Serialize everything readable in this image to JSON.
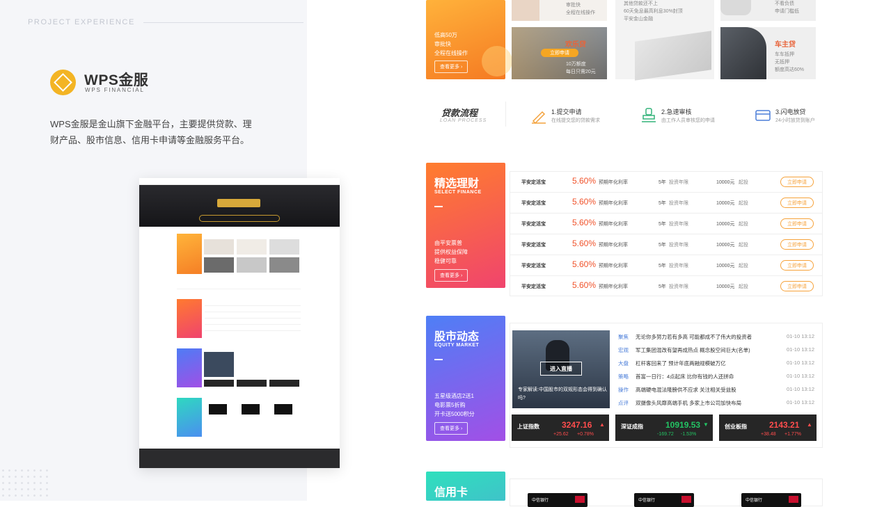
{
  "left": {
    "label": "PROJECT EXPERIENCE",
    "logo_title": "WPS金服",
    "logo_subtitle": "WPS FINANCIAL",
    "intro": "WPS金服是金山旗下金融平台，主要提供贷款、理财产品、股市信息、信用卡申请等金融服务平台。"
  },
  "loan_card": {
    "lines": [
      "低高50万",
      "审批快",
      "全程在线操作"
    ],
    "more_label": "查看更多 ›"
  },
  "top_snippets": {
    "a_lines": [
      "审批快",
      "全程在线操作"
    ],
    "b_lines": [
      "其他贷款还不上",
      "60天免息最高利息30%封顶",
      "平安金山金融"
    ],
    "c_lines": [
      "不看负债",
      "申请门槛低"
    ]
  },
  "products": [
    {
      "name": "欢乐贷",
      "button": "立即申请",
      "lines": [
        "10万额度",
        "每日只需20元"
      ]
    },
    {
      "name": "车主贷",
      "lines": [
        "车车抵押",
        "无抵押",
        "额度高达60%"
      ]
    }
  ],
  "loan_process": {
    "title": "贷款流程",
    "subtitle": "LOAN PROCESS",
    "steps": [
      {
        "title": "1.提交申请",
        "desc": "在线提交您的贷款需求",
        "icon": "pen-icon",
        "color": "#f4a23c"
      },
      {
        "title": "2.急速审核",
        "desc": "由工作人员审核您的申请",
        "icon": "stamp-icon",
        "color": "#33b37a"
      },
      {
        "title": "3.闪电放贷",
        "desc": "24小时放贷到账户",
        "icon": "card-icon",
        "color": "#4b7ed9"
      }
    ]
  },
  "finance": {
    "title": "精选理财",
    "subtitle": "SELECT FINANCE",
    "lines": [
      "由平安票普",
      "提供权益保障",
      "稳健可靠"
    ],
    "more_label": "查看更多 ›",
    "rows": [
      {
        "name": "平安定活宝",
        "rate": "5.60%",
        "rate_label": "预期年化利率",
        "term": "5年",
        "term_label": "投资年限",
        "amount": "10000元",
        "amount_label": "起投",
        "button": "立即申请"
      },
      {
        "name": "平安定活宝",
        "rate": "5.60%",
        "rate_label": "预期年化利率",
        "term": "5年",
        "term_label": "投资年限",
        "amount": "10000元",
        "amount_label": "起投",
        "button": "立即申请"
      },
      {
        "name": "平安定活宝",
        "rate": "5.60%",
        "rate_label": "预期年化利率",
        "term": "5年",
        "term_label": "投资年限",
        "amount": "10000元",
        "amount_label": "起投",
        "button": "立即申请"
      },
      {
        "name": "平安定活宝",
        "rate": "5.60%",
        "rate_label": "预期年化利率",
        "term": "5年",
        "term_label": "投资年限",
        "amount": "10000元",
        "amount_label": "起投",
        "button": "立即申请"
      },
      {
        "name": "平安定活宝",
        "rate": "5.60%",
        "rate_label": "预期年化利率",
        "term": "5年",
        "term_label": "投资年限",
        "amount": "10000元",
        "amount_label": "起投",
        "button": "立即申请"
      },
      {
        "name": "平安定活宝",
        "rate": "5.60%",
        "rate_label": "预期年化利率",
        "term": "5年",
        "term_label": "投资年限",
        "amount": "10000元",
        "amount_label": "起投",
        "button": "立即申请"
      }
    ]
  },
  "equity": {
    "title": "股市动态",
    "subtitle": "EQUITY MARKET",
    "lines": [
      "五星级酒店2送1",
      "电影票5折购",
      "开卡送5000积分"
    ],
    "more_label": "查看更多 ›",
    "live_button": "进入直播",
    "caption": "专家解读:中国股市的双规形态会得到确认吗?",
    "news": [
      {
        "tag": "聚焦",
        "title": "无论你多努力若有多高 可能都成不了伟大的投资者",
        "time": "01-10 13:12"
      },
      {
        "tag": "宏观",
        "title": "军工集团混改有望再成热点 概念股空间巨大(名单)",
        "time": "01-10 13:12"
      },
      {
        "tag": "大盘",
        "title": "杠杆客回来了 预计年底两融规模破万亿",
        "time": "01-10 13:12"
      },
      {
        "tag": "策略",
        "title": "首富一日行：4点起床 比你有钱的人还拼命",
        "time": "01-10 13:12"
      },
      {
        "tag": "操作",
        "title": "高端硬电混法隆膀供不应求 关注相关受益股",
        "time": "01-10 13:12"
      },
      {
        "tag": "点评",
        "title": "双摄像头风靡高端手机 多家上市公司加快布局",
        "time": "01-10 13:12"
      }
    ],
    "indices": [
      {
        "name": "上证指数",
        "value": "3247.16",
        "change": "+25.62",
        "pct": "+0.78%",
        "dir": "up",
        "color": "#ff4d4d",
        "arrow": "▲"
      },
      {
        "name": "深证成指",
        "value": "10919.53",
        "change": "-169.72",
        "pct": "-1.53%",
        "dir": "down",
        "color": "#23c464",
        "arrow": "▼"
      },
      {
        "name": "创业板指",
        "value": "2143.21",
        "change": "+38.48",
        "pct": "+1.77%",
        "dir": "up",
        "color": "#ff4d4d",
        "arrow": "▲"
      }
    ]
  },
  "credit": {
    "title": "信用卡",
    "bank_labels": [
      "中信银行",
      "中信银行",
      "中信银行"
    ]
  },
  "mini_preview": {
    "banner_title": "金山 金融",
    "stats": [
      "30",
      "4",
      "70"
    ]
  }
}
